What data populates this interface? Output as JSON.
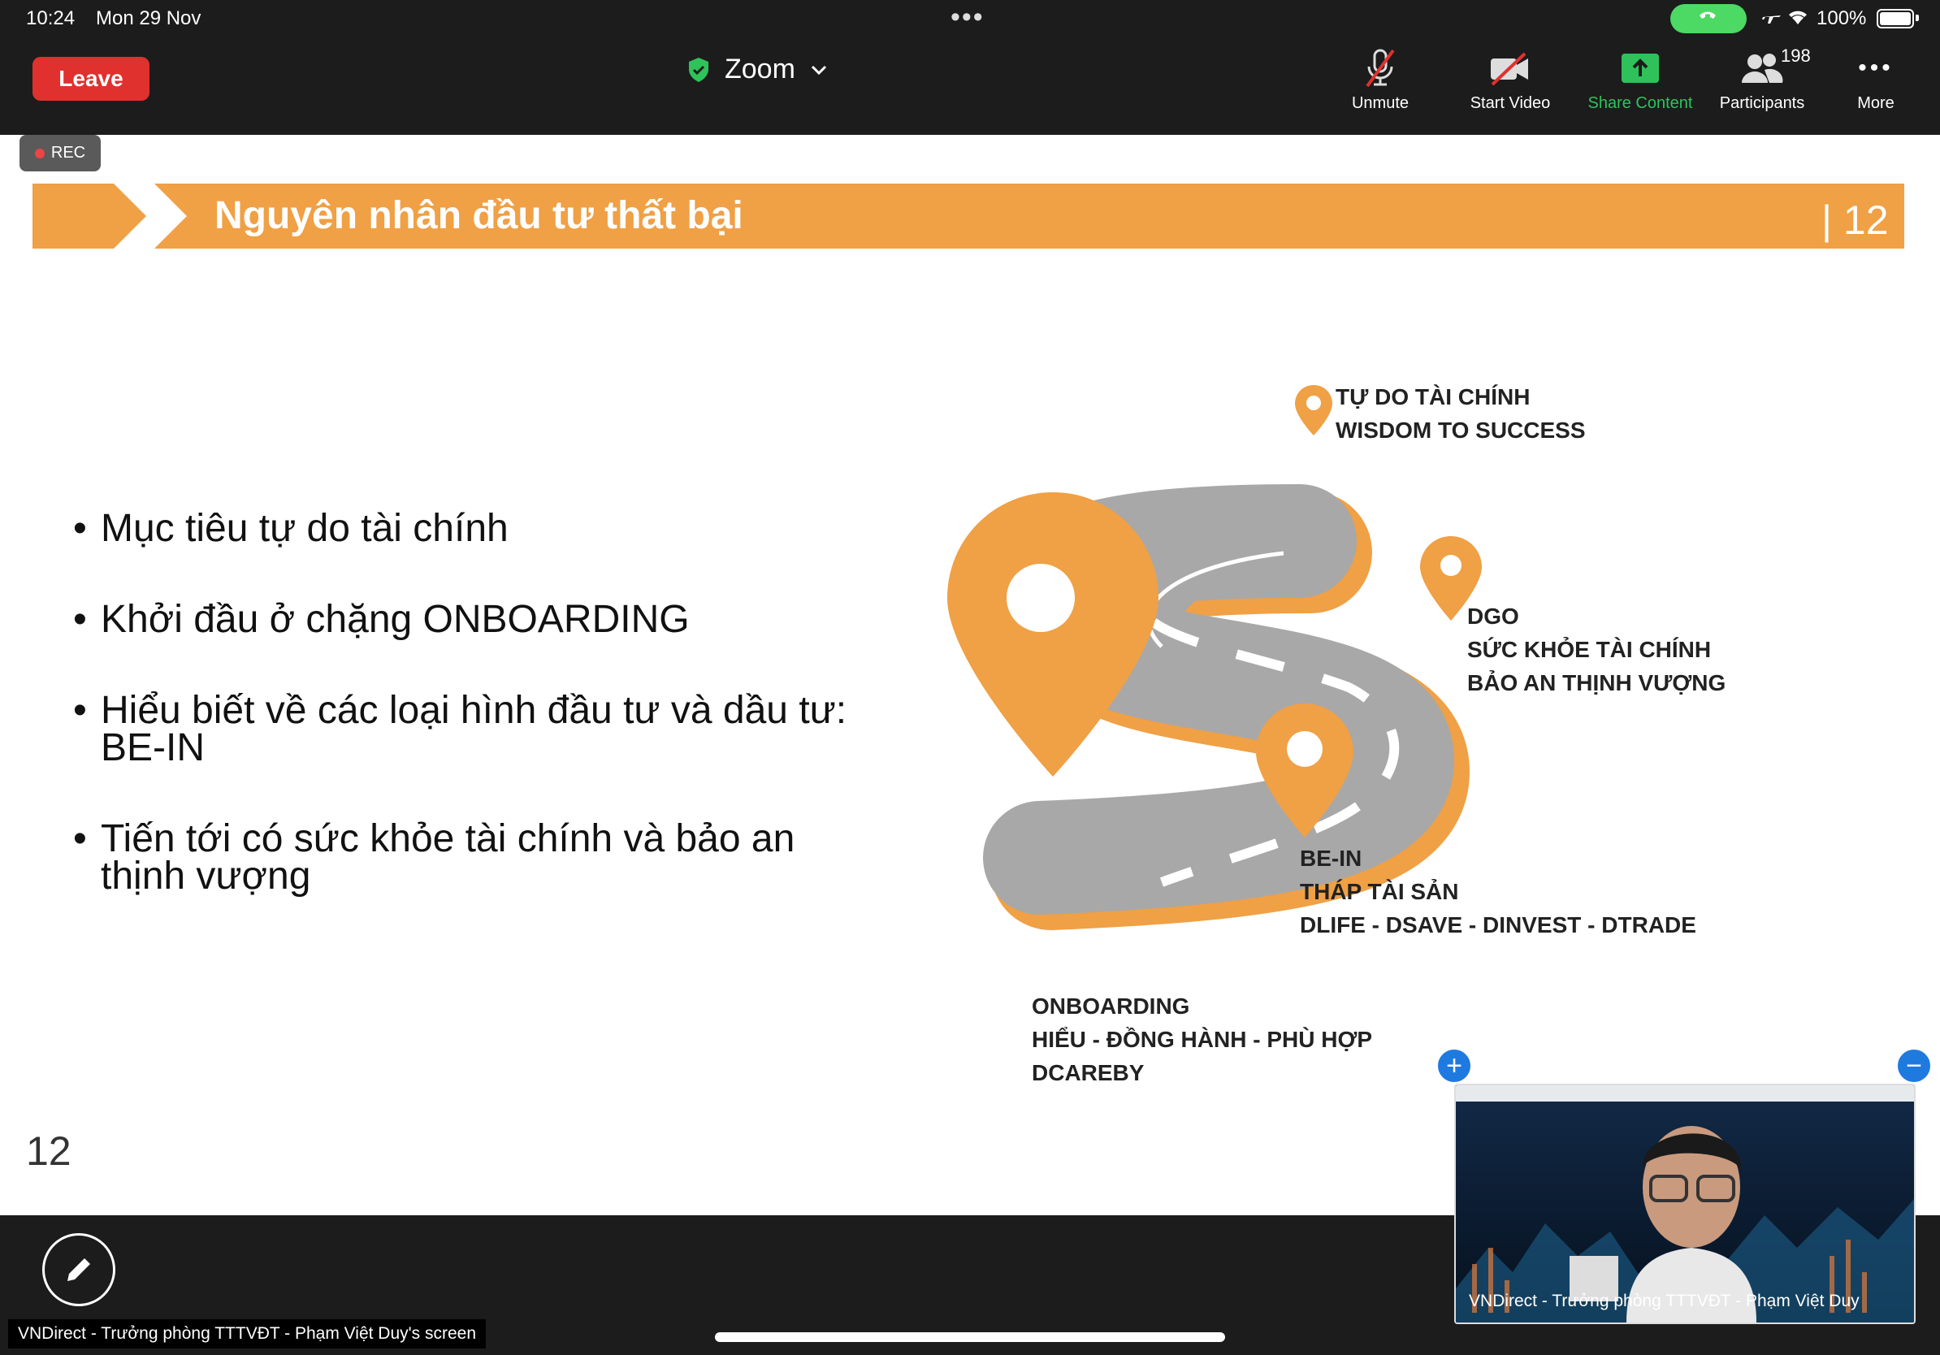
{
  "status_bar": {
    "time": "10:24",
    "date": "Mon 29 Nov",
    "battery": "100%"
  },
  "toolbar": {
    "leave_label": "Leave",
    "meeting_title": "Zoom",
    "unmute_label": "Unmute",
    "start_video_label": "Start Video",
    "share_content_label": "Share Content",
    "participants_label": "Participants",
    "participants_count": "198",
    "more_label": "More"
  },
  "slide": {
    "rec_label": "REC",
    "title": "Nguyên nhân đầu tư thất bại",
    "page_marker": "| 12",
    "slide_number": "12",
    "bullets": [
      "Mục tiêu tự do tài chính",
      "Khởi đầu ở chặng ONBOARDING",
      "Hiểu biết về các loại hình đầu tư và dầu tư: BE-IN",
      "Tiến tới có sức khỏe tài chính và bảo an thịnh vượng"
    ],
    "roadmap": {
      "top": [
        "TỰ DO TÀI CHÍNH",
        "WISDOM TO SUCCESS"
      ],
      "dgo": [
        "DGO",
        "SỨC KHỎE TÀI CHÍNH",
        "BẢO AN THỊNH VƯỢNG"
      ],
      "bein": [
        "BE-IN",
        "THÁP TÀI SẢN",
        "DLIFE - DSAVE - DINVEST - DTRADE"
      ],
      "onboarding": [
        "ONBOARDING",
        "HIỂU - ĐỒNG HÀNH - PHÙ HỢP",
        "DCAREBY"
      ]
    }
  },
  "bottom": {
    "screen_share_label": "VNDirect - Trưởng phòng TTTVĐT - Phạm Việt Duy's screen",
    "video_name": "VNDirect - Trưởng phòng TTTVĐT - Phạm Việt Duy"
  },
  "colors": {
    "accent_orange": "#f0a045",
    "leave_red": "#e0312e",
    "share_green": "#2fc25b",
    "road_gray": "#a8a8a8"
  }
}
